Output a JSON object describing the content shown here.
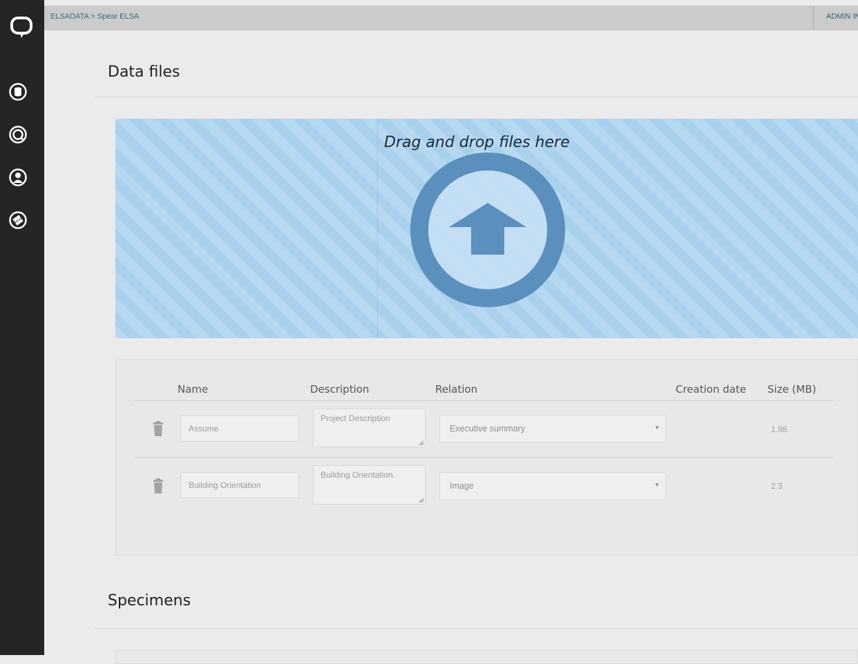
{
  "topbar": {
    "breadcrumb": "ELSADATA > Spear ELSA",
    "admin_link": "ADMIN INTERFACE"
  },
  "sidebar": {
    "icons": [
      "logo-chat-icon",
      "database-icon",
      "search-icon",
      "user-icon",
      "manual-icon"
    ]
  },
  "data_files": {
    "title": "Data files",
    "dropzone_text": "Drag and drop files here",
    "columns": [
      "Name",
      "Description",
      "Relation",
      "Creation date",
      "Size (MB)"
    ],
    "rows": [
      {
        "name": "Assume",
        "description": "Project Description",
        "relation": "Executive summary",
        "creation_date": "",
        "size": "1.98"
      },
      {
        "name": "Building Orientation",
        "description": "Building Orientation.",
        "relation": "Image",
        "creation_date": "",
        "size": "2.3"
      }
    ]
  },
  "specimens": {
    "title": "Specimens"
  },
  "colors": {
    "sidebar": "#252525",
    "dropzone": "#a9d1ee",
    "upload_circle": "#5b8fbd",
    "link": "#2f6078"
  }
}
